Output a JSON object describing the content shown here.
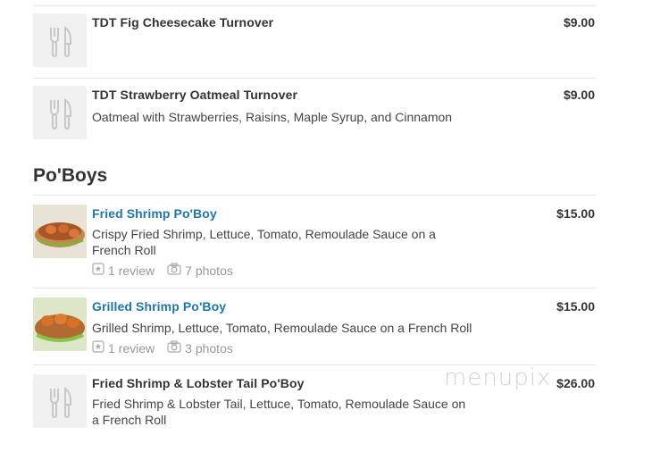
{
  "menu": {
    "items_top": [
      {
        "title": "TDT Fig Cheesecake Turnover",
        "price": "$9.00",
        "description": ""
      },
      {
        "title": "TDT Strawberry Oatmeal Turnover",
        "price": "$9.00",
        "description": "Oatmeal with Strawberries, Raisins, Maple Syrup, and Cinnamon"
      }
    ],
    "section": {
      "title": "Po'Boys"
    },
    "items": [
      {
        "title": "Fried Shrimp Po'Boy",
        "price": "$15.00",
        "description_line1": "Crispy Fried Shrimp, Lettuce, Tomato, Remoulade Sauce on a",
        "description_line2": "French Roll",
        "reviews": "1 review",
        "photos": "7 photos"
      },
      {
        "title": "Grilled Shrimp Po'Boy",
        "price": "$15.00",
        "description_line1": "Grilled Shrimp, Lettuce, Tomato, Remoulade Sauce on a French Roll",
        "reviews": "1 review",
        "photos": "3 photos"
      },
      {
        "title": "Fried Shrimp & Lobster Tail Po'Boy",
        "price": "$26.00",
        "description_line1": "Fried Shrimp & Lobster Tail, Lettuce, Tomato, Remoulade Sauce on",
        "description_line2": "a French Roll"
      }
    ]
  },
  "watermark": "menupix",
  "colors": {
    "link": "#1f77a8",
    "divider": "#e6e6e6",
    "placeholder_bg": "#f1f1f1"
  }
}
